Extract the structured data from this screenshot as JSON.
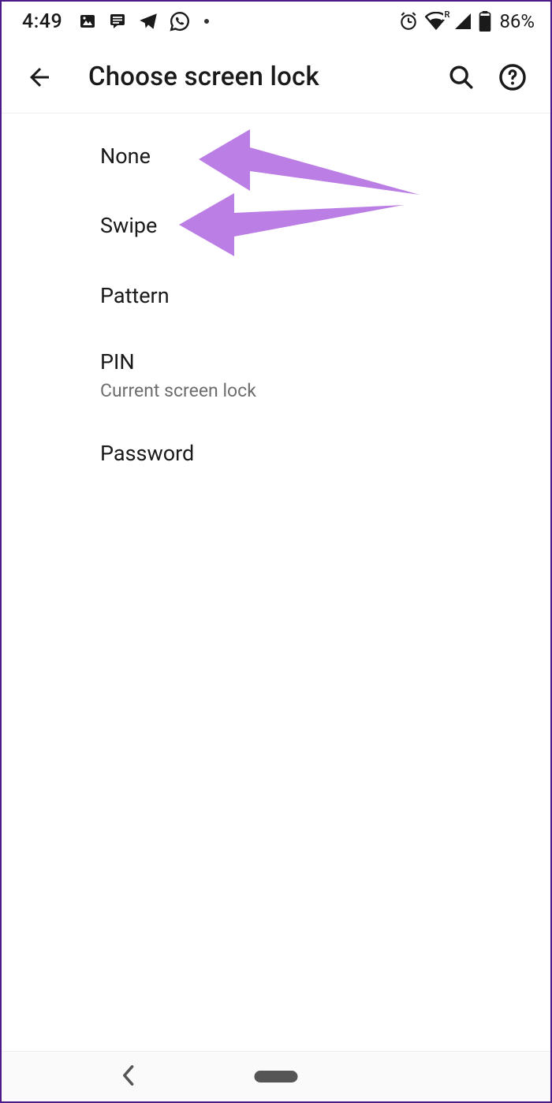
{
  "status": {
    "time": "4:49",
    "battery": "86%",
    "wifi_label": "R"
  },
  "header": {
    "title": "Choose screen lock"
  },
  "options": {
    "none": "None",
    "swipe": "Swipe",
    "pattern": "Pattern",
    "pin": "PIN",
    "pin_sub": "Current screen lock",
    "password": "Password"
  },
  "annotation": {
    "color": "#bb7ee5"
  }
}
